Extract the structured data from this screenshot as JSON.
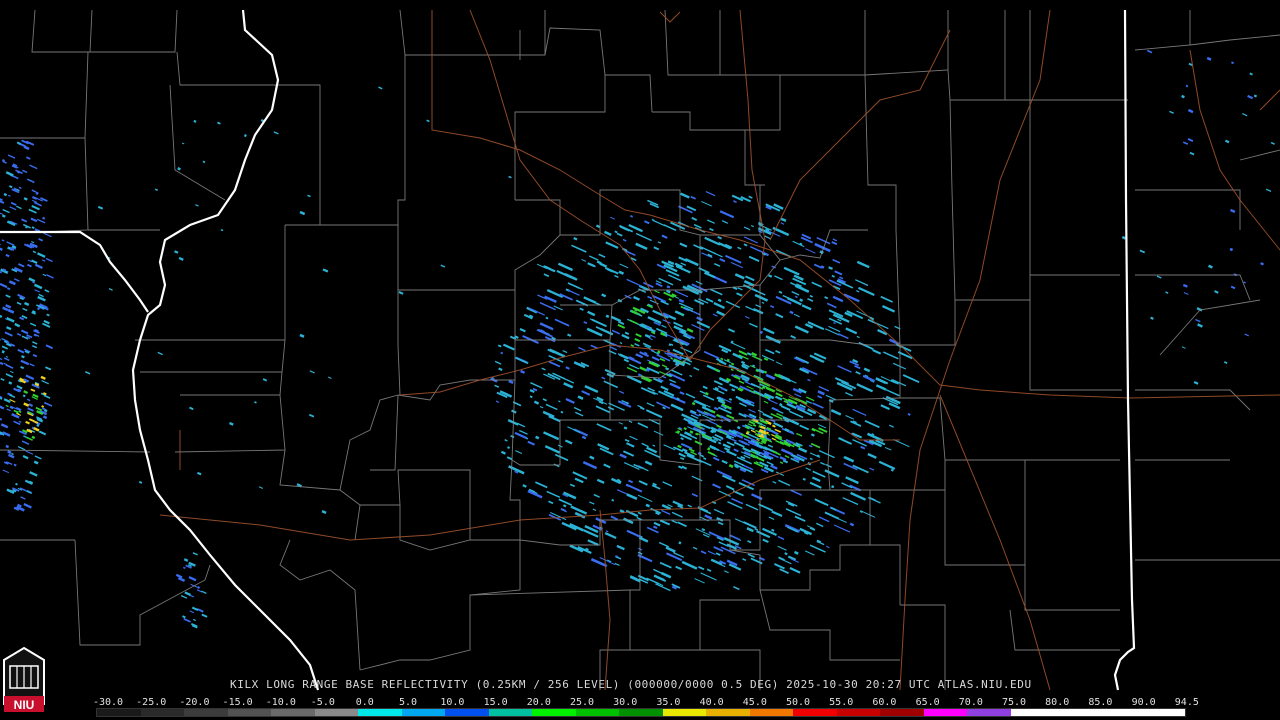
{
  "map": {
    "caption": "KILX LONG RANGE BASE REFLECTIVITY (0.25KM / 256 LEVEL) (000000/0000 0.5 DEG) 2025-10-30 20:27 UTC  ATLAS.NIU.EDU",
    "logo_text": "NIU",
    "colors": {
      "background": "#000000",
      "state_border": "#ffffff",
      "county_border": "#8c8c8c",
      "highway": "#a0522d",
      "echo_light": "#2bb3d6",
      "echo_moderate": "#3a6cf0",
      "echo_strong": "#2fd02f",
      "echo_heavy": "#f0d020"
    },
    "scale": {
      "labels": [
        "-30.0",
        "-25.0",
        "-20.0",
        "-15.0",
        "-10.0",
        "-5.0",
        "0.0",
        "5.0",
        "10.0",
        "15.0",
        "20.0",
        "25.0",
        "30.0",
        "35.0",
        "40.0",
        "45.0",
        "50.0",
        "55.0",
        "60.0",
        "65.0",
        "70.0",
        "75.0",
        "80.0",
        "85.0",
        "90.0",
        "94.5"
      ],
      "colors": [
        "#1a1a1a",
        "#2a2a2a",
        "#3c3c3c",
        "#525252",
        "#6a6a6a",
        "#8a8a8a",
        "#00e8e8",
        "#00a8f0",
        "#0050f0",
        "#00c0a0",
        "#00f000",
        "#00c000",
        "#009000",
        "#e8e800",
        "#e8b000",
        "#f07800",
        "#f00000",
        "#c80000",
        "#a00000",
        "#ff00ff",
        "#9040e0",
        "#ffffff",
        "#ffffff",
        "#ffffff",
        "#ffffff"
      ]
    }
  }
}
